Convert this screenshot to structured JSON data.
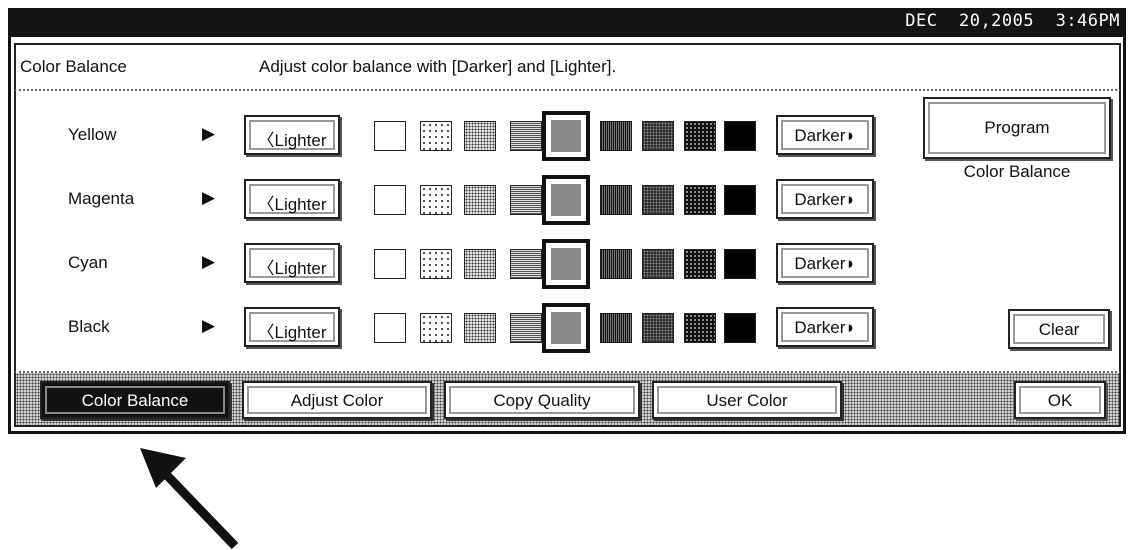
{
  "status": {
    "datetime": "DEC  20,2005  3:46PM"
  },
  "header": {
    "title": "Color Balance",
    "message": "Adjust color balance with [Darker] and [Lighter]."
  },
  "rows": [
    {
      "label": "Yellow",
      "lighter_label": "〈Lighter",
      "darker_label": "Darker◗",
      "selected_level": 5,
      "levels": 9
    },
    {
      "label": "Magenta",
      "lighter_label": "〈Lighter",
      "darker_label": "Darker◗",
      "selected_level": 5,
      "levels": 9
    },
    {
      "label": "Cyan",
      "lighter_label": "〈Lighter",
      "darker_label": "Darker◗",
      "selected_level": 5,
      "levels": 9
    },
    {
      "label": "Black",
      "lighter_label": "〈Lighter",
      "darker_label": "Darker◗",
      "selected_level": 5,
      "levels": 9
    }
  ],
  "row_arrow": "▶",
  "program_button": {
    "line1": "Program",
    "line2": "Color Balance"
  },
  "clear_button": "Clear",
  "tabs": [
    {
      "label": "Color Balance",
      "active": true
    },
    {
      "label": "Adjust Color",
      "active": false
    },
    {
      "label": "Copy Quality",
      "active": false
    },
    {
      "label": "User Color",
      "active": false
    }
  ],
  "ok_button": "OK"
}
